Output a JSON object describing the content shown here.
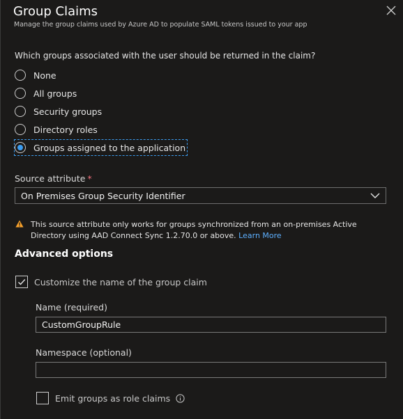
{
  "header": {
    "title": "Group Claims",
    "subtitle": "Manage the group claims used by Azure AD to populate SAML tokens issued to your app"
  },
  "groups_question": "Which groups associated with the user should be returned in the claim?",
  "group_options": [
    {
      "label": "None",
      "selected": false
    },
    {
      "label": "All groups",
      "selected": false
    },
    {
      "label": "Security groups",
      "selected": false
    },
    {
      "label": "Directory roles",
      "selected": false
    },
    {
      "label": "Groups assigned to the application",
      "selected": true
    }
  ],
  "source_attribute": {
    "label": "Source attribute",
    "required_marker": "*",
    "value": "On Premises Group Security Identifier"
  },
  "warning": {
    "text": "This source attribute only works for groups synchronized from an on-premises Active Directory using AAD Connect Sync 1.2.70.0 or above.",
    "link": "Learn More"
  },
  "advanced": {
    "heading": "Advanced options",
    "customize_label": "Customize the name of the group claim",
    "customize_checked": true,
    "name_label": "Name (required)",
    "name_value": "CustomGroupRule",
    "namespace_label": "Namespace (optional)",
    "namespace_value": "",
    "emit_label": "Emit groups as role claims",
    "emit_checked": false
  },
  "colors": {
    "background": "#1b1a19",
    "accent": "#3b9cf0",
    "link": "#5db0ff",
    "required": "#f1707b",
    "warning": "#f7a12b"
  },
  "icons": {
    "close": "close-icon",
    "dropdown": "chevron-down-icon",
    "warning": "warning-icon",
    "check": "checkmark-icon",
    "info": "info-icon"
  }
}
